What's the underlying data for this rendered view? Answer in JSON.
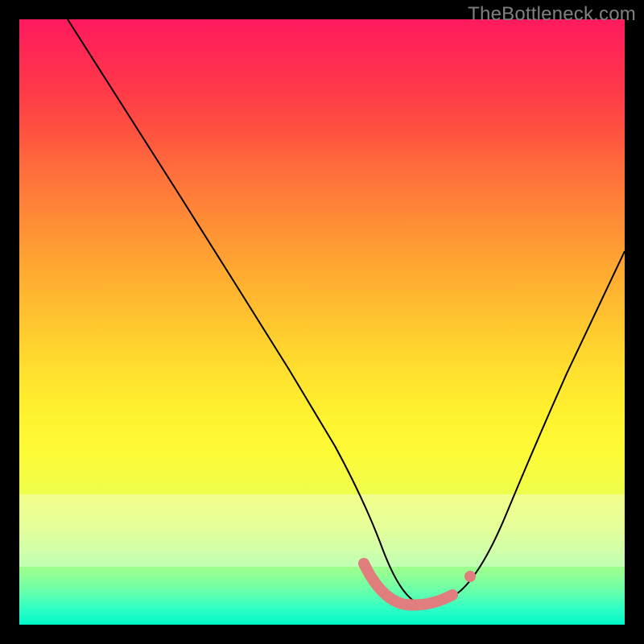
{
  "watermark": "TheBottleneck.com",
  "colors": {
    "black": "#000000",
    "pink": "#e07e7e",
    "grey": "#808080"
  },
  "chart_data": {
    "type": "line",
    "title": "",
    "xlabel": "",
    "ylabel": "",
    "xlim": [
      0,
      100
    ],
    "ylim": [
      0,
      100
    ],
    "grid": false,
    "legend": false,
    "series": [
      {
        "name": "bottleneck-curve",
        "x": [
          8,
          12,
          16,
          20,
          24,
          28,
          32,
          36,
          40,
          44,
          48,
          52,
          55,
          58,
          62,
          66,
          70,
          74,
          78,
          82,
          86,
          90,
          94,
          100
        ],
        "y": [
          100,
          93,
          86,
          79,
          72,
          64,
          57,
          50,
          42,
          35,
          27,
          20,
          14,
          9,
          5,
          3,
          3,
          6,
          12,
          20,
          29,
          38,
          47,
          62
        ]
      },
      {
        "name": "optimal-range",
        "x": [
          55,
          58,
          62,
          66,
          70,
          74
        ],
        "y": [
          9,
          5,
          3,
          3,
          3,
          6
        ]
      }
    ],
    "annotations": [
      {
        "name": "optimal-end-dot",
        "x": 74,
        "y": 6
      }
    ],
    "bright_band_y": [
      10,
      22
    ]
  }
}
